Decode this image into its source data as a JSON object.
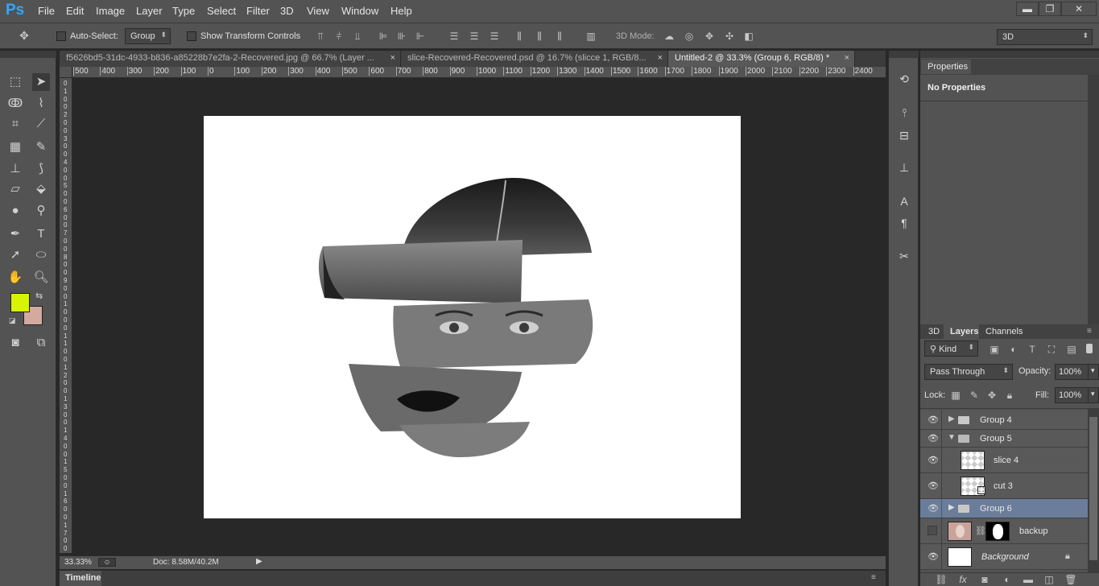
{
  "app": {
    "logo": "Ps"
  },
  "menu": [
    "File",
    "Edit",
    "Image",
    "Layer",
    "Type",
    "Select",
    "Filter",
    "3D",
    "View",
    "Window",
    "Help"
  ],
  "window_controls": {
    "minimize": "▬",
    "restore": "❐",
    "close": "✕"
  },
  "options": {
    "auto_select_label": "Auto-Select:",
    "auto_select_value": "Group",
    "show_transform_label": "Show Transform Controls",
    "mode_3d_label": "3D Mode:",
    "workspace_value": "3D"
  },
  "tabs": [
    {
      "label": "f5626bd5-31dc-4933-b836-a85228b7e2fa-2-Recovered.jpg @ 66.7% (Layer ...",
      "close": "×"
    },
    {
      "label": "slice-Recovered-Recovered.psd @ 16.7% (slicce 1, RGB/8...",
      "close": "×"
    },
    {
      "label": "Untitled-2 @ 33.3% (Group 6, RGB/8) *",
      "close": "×"
    }
  ],
  "ruler_h": [
    "500",
    "400",
    "300",
    "200",
    "100",
    "0",
    "100",
    "200",
    "300",
    "400",
    "500",
    "600",
    "700",
    "800",
    "900",
    "1000",
    "1100",
    "1200",
    "1300",
    "1400",
    "1500",
    "1600",
    "1700",
    "1800",
    "1900",
    "2000",
    "2100",
    "2200",
    "2300",
    "2400"
  ],
  "ruler_v": [
    "0",
    "1",
    "0",
    "0",
    "2",
    "0",
    "0",
    "3",
    "0",
    "0",
    "4",
    "0",
    "0",
    "5",
    "0",
    "0",
    "6",
    "0",
    "0",
    "7",
    "0",
    "0",
    "8",
    "0",
    "0",
    "9",
    "0",
    "0",
    "1",
    "0",
    "0",
    "0",
    "1",
    "1",
    "0",
    "0",
    "1",
    "2",
    "0",
    "0",
    "1",
    "3",
    "0",
    "0",
    "1",
    "4",
    "0",
    "0",
    "1",
    "5",
    "0",
    "0",
    "1",
    "6",
    "0",
    "0",
    "1",
    "7",
    "0",
    "0"
  ],
  "colors": {
    "foreground": "#d7f500",
    "background": "#d4aaa0",
    "canvas": "#282828",
    "panel": "#535353",
    "selected_layer": "#6a7d9a"
  },
  "status": {
    "zoom": "33.33%",
    "doc": "Doc: 8.58M/40.2M"
  },
  "timeline_label": "Timeline",
  "properties": {
    "tab": "Properties",
    "text": "No Properties"
  },
  "layers_panel": {
    "tabs": [
      "3D",
      "Layers",
      "Channels"
    ],
    "kind_label": "Kind",
    "blend_mode": "Pass Through",
    "opacity_label": "Opacity:",
    "opacity_value": "100%",
    "lock_label": "Lock:",
    "fill_label": "Fill:",
    "fill_value": "100%",
    "layers": [
      {
        "name": "Group 4",
        "type": "group",
        "expanded": false,
        "visible": true
      },
      {
        "name": "Group 5",
        "type": "group",
        "expanded": true,
        "visible": true
      },
      {
        "name": "slice 4",
        "type": "layer",
        "visible": true
      },
      {
        "name": "cut 3",
        "type": "layer",
        "visible": true
      },
      {
        "name": "Group 6",
        "type": "group",
        "expanded": false,
        "visible": true,
        "selected": true
      },
      {
        "name": "backup",
        "type": "masked",
        "visible": false
      },
      {
        "name": "Background",
        "type": "background",
        "visible": true,
        "locked": true
      }
    ]
  }
}
